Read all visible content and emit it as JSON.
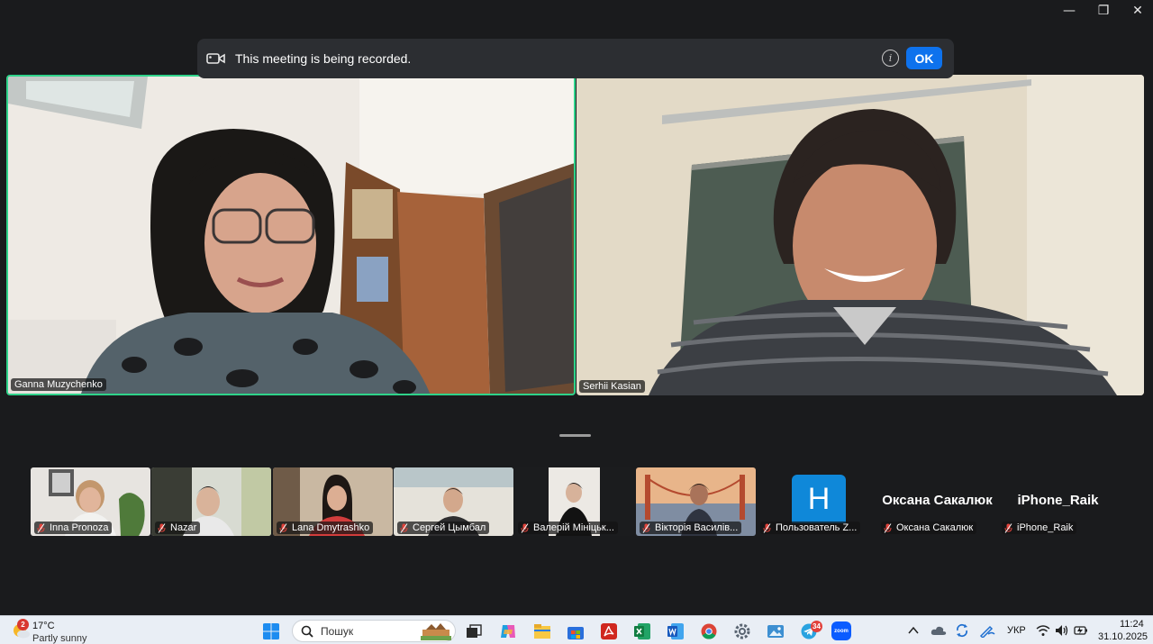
{
  "window": {
    "minimize_glyph": "—",
    "maximize_glyph": "❐",
    "close_glyph": "✕"
  },
  "banner": {
    "text": "This meeting is being recorded.",
    "info_glyph": "i",
    "ok_label": "OK"
  },
  "speakers": [
    {
      "name": "Ganna Muzychenko",
      "active": true
    },
    {
      "name": "Serhii Kasian",
      "active": false
    }
  ],
  "participants": [
    {
      "name": "Inna Pronoza",
      "muted": true
    },
    {
      "name": "Nazar",
      "muted": true
    },
    {
      "name": "Lana Dmytrashko",
      "muted": true
    },
    {
      "name": "Сергей Цымбал",
      "muted": true
    },
    {
      "name": "Валерій Мініцьк...",
      "muted": true
    },
    {
      "name": "Вікторія Василів...",
      "muted": true
    },
    {
      "name": "Пользователь Z...",
      "muted": true,
      "avatar_letter": "H"
    },
    {
      "name": "Оксана Сакалюк",
      "muted": true,
      "display_name": "Оксана Сакалюк"
    },
    {
      "name": "iPhone_Raik",
      "muted": true,
      "display_name": "iPhone_Raik"
    }
  ],
  "taskbar": {
    "weather_badge": "2",
    "weather_temp": "17°C",
    "weather_desc": "Partly sunny",
    "search_placeholder": "Пошук",
    "telegram_badge": "34",
    "zoom_label": "zoom",
    "language": "УКР",
    "time": "11:24",
    "date": "31.10.2025"
  },
  "colors": {
    "active_speaker_border": "#2fd38a",
    "ok_button": "#0e72ed",
    "avatar_h": "#0f88d9",
    "muted_mic": "#e0433b"
  }
}
